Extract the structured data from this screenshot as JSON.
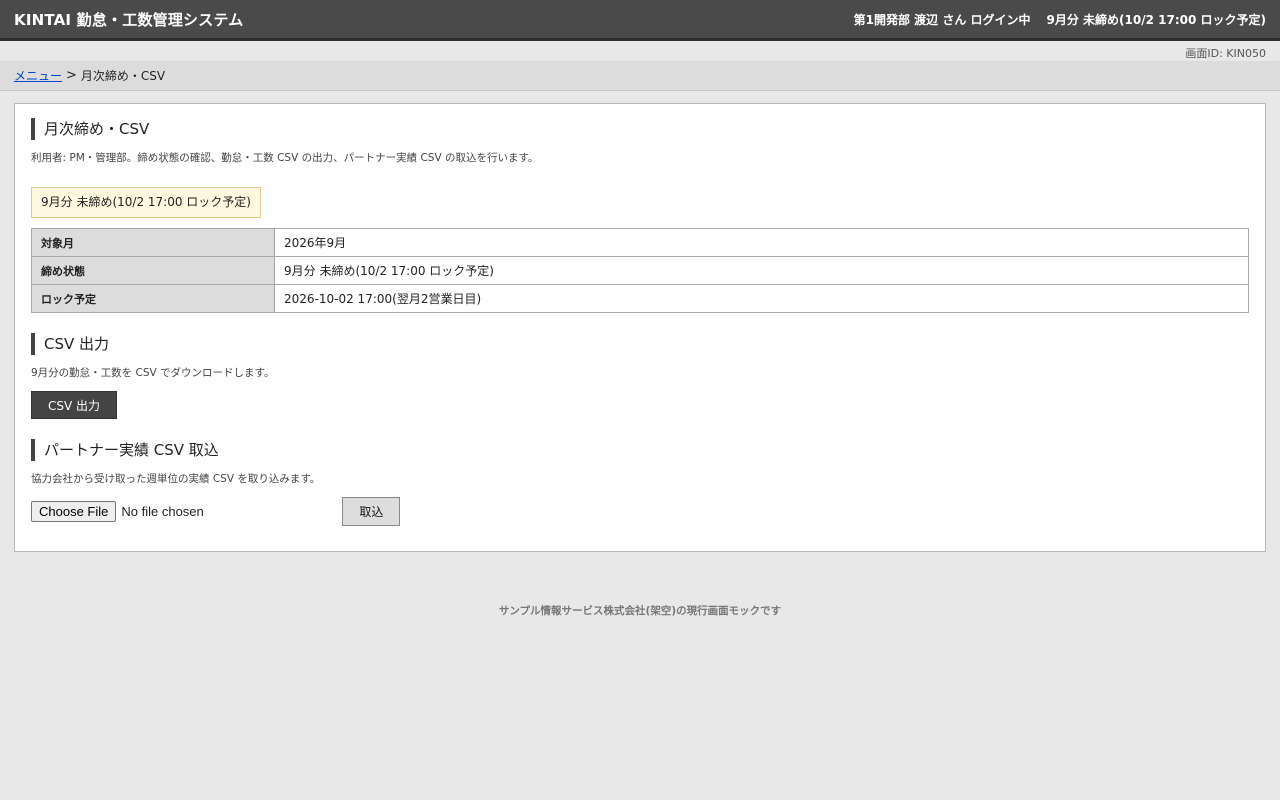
{
  "header": {
    "app_title": "KINTAI 勤怠・工数管理システム",
    "user_info": "第1開発部 渡辺 さん ログイン中",
    "closing_status": "9月分 未締め(10/2 17:00 ロック予定)"
  },
  "screen_id": "画面ID: KIN050",
  "breadcrumb": {
    "menu_link": "メニュー",
    "separator": ">",
    "current": "月次締め・CSV"
  },
  "main": {
    "title": "月次締め・CSV",
    "description": "利用者: PM・管理部。締め状態の確認、勤怠・工数 CSV の出力、パートナー実績 CSV の取込を行います。",
    "status_badge": "9月分 未締め(10/2 17:00 ロック予定)",
    "info_table": [
      {
        "label": "対象月",
        "value": "2026年9月"
      },
      {
        "label": "締め状態",
        "value": "9月分 未締め(10/2 17:00 ロック予定)"
      },
      {
        "label": "ロック予定",
        "value": "2026-10-02 17:00(翌月2営業日目)"
      }
    ]
  },
  "csv_export": {
    "title": "CSV 出力",
    "description": "9月分の勤怠・工数を CSV でダウンロードします。",
    "button_label": "CSV 出力"
  },
  "partner_import": {
    "title": "パートナー実績 CSV 取込",
    "description": "協力会社から受け取った週単位の実績 CSV を取り込みます。",
    "choose_file_label": "Choose File",
    "no_file_text": "No file chosen",
    "import_button_label": "取込"
  },
  "footer": "サンプル情報サービス株式会社(架空)の現行画面モックです",
  "colors": {
    "header_bg": "#4a4a4a",
    "status_bg": "#fff8e1",
    "status_border": "#e6c98a",
    "link": "#0044cc"
  }
}
